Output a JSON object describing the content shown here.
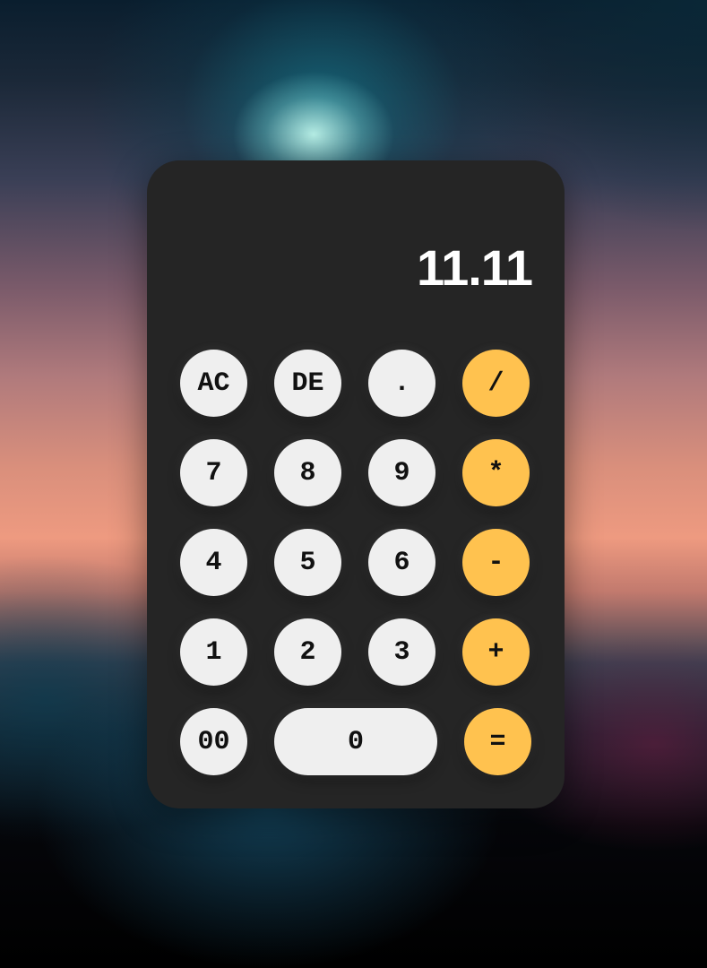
{
  "display": {
    "value": "11.11"
  },
  "keys": {
    "ac": "AC",
    "de": "DE",
    "dot": ".",
    "divide": "/",
    "seven": "7",
    "eight": "8",
    "nine": "9",
    "multiply": "*",
    "four": "4",
    "five": "5",
    "six": "6",
    "subtract": "-",
    "one": "1",
    "two": "2",
    "three": "3",
    "add": "+",
    "double_zero": "00",
    "zero": "0",
    "equals": "="
  },
  "colors": {
    "panel": "#252525",
    "number_key": "#efefef",
    "operator_key": "#ffc24f",
    "display_text": "#ffffff"
  }
}
